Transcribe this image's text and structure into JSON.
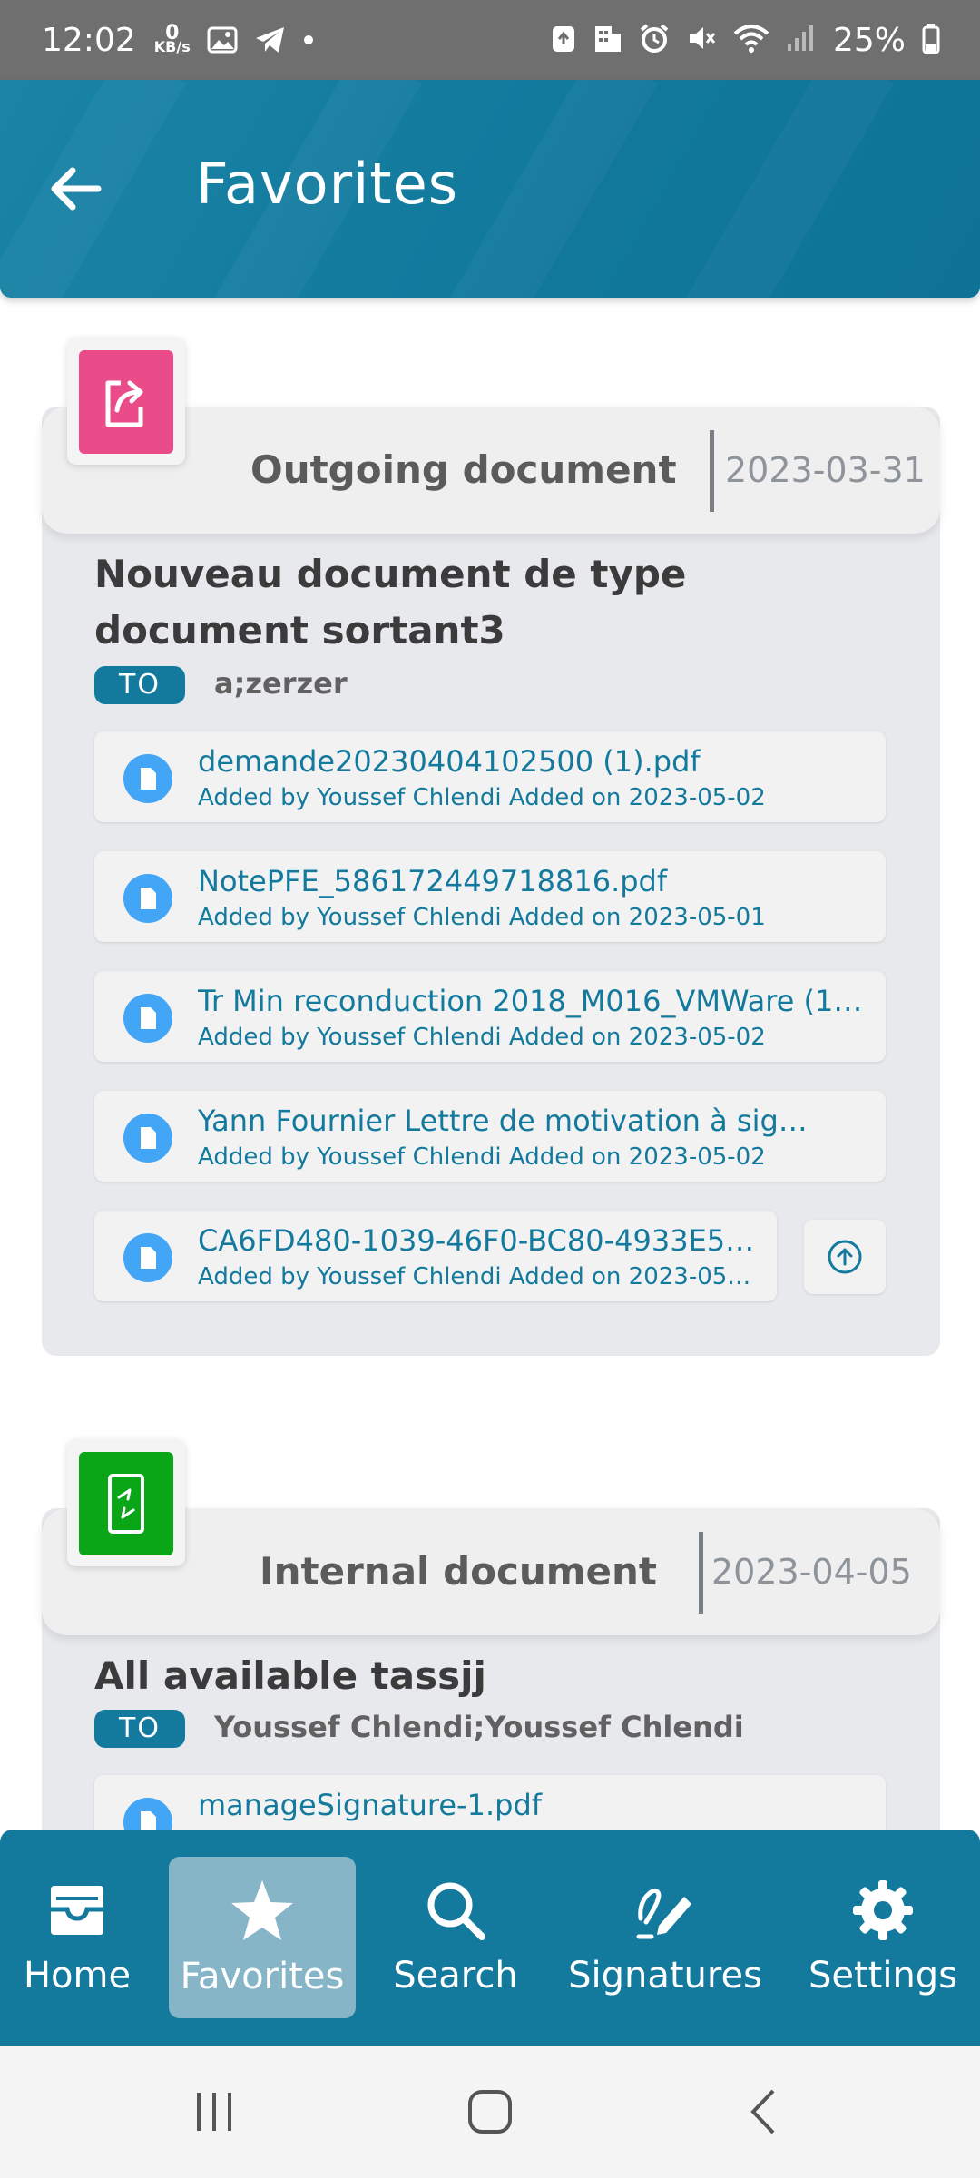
{
  "status_bar": {
    "time": "12:02",
    "net_speed_value": "0",
    "net_speed_unit": "KB/s",
    "battery": "25%"
  },
  "app_bar": {
    "title": "Favorites"
  },
  "cards": [
    {
      "type": "Outgoing document",
      "date": "2023-03-31",
      "badge_color": "#ea4c89",
      "title": "Nouveau document de type document sortant3",
      "to_label": "TO",
      "to_value": "a;zerzer",
      "files": [
        {
          "name": "demande20230404102500 (1).pdf",
          "meta": "Added by Youssef Chlendi Added on 2023-05-02"
        },
        {
          "name": "NotePFE_586172449718816.pdf",
          "meta": "Added by Youssef Chlendi Added on 2023-05-01"
        },
        {
          "name": "Tr Min reconduction 2018_M016_VMWare (1…",
          "meta": "Added by Youssef Chlendi Added on 2023-05-02"
        },
        {
          "name": "Yann Fournier Lettre de motivation à sig…",
          "meta": "Added by Youssef Chlendi Added on 2023-05-02"
        },
        {
          "name": "CA6FD480-1039-46F0-BC80-4933E5…",
          "meta": "Added by Youssef Chlendi Added on 2023-05…"
        }
      ]
    },
    {
      "type": "Internal document",
      "date": "2023-04-05",
      "badge_color": "#0aa617",
      "title": "All available tassjj",
      "to_label": "TO",
      "to_value": "Youssef Chlendi;Youssef Chlendi",
      "files": [
        {
          "name": "manageSignature-1.pdf",
          "meta": ""
        }
      ]
    }
  ],
  "bottom_nav": {
    "items": [
      {
        "label": "Home",
        "icon": "inbox-icon"
      },
      {
        "label": "Favorites",
        "icon": "star-icon",
        "active": true
      },
      {
        "label": "Search",
        "icon": "search-icon"
      },
      {
        "label": "Signatures",
        "icon": "signature-pen-icon"
      },
      {
        "label": "Settings",
        "icon": "gear-icon"
      }
    ]
  },
  "colors": {
    "primary": "#137a9e",
    "file_text": "#137a9e",
    "file_icon_bg": "#42a5f5"
  }
}
